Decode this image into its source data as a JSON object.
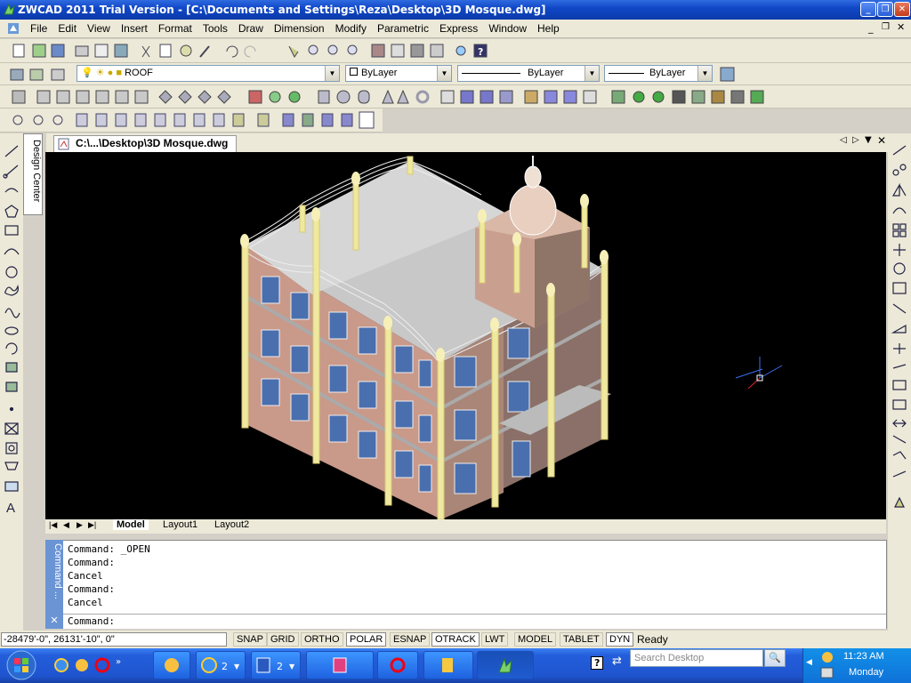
{
  "window": {
    "title": "ZWCAD 2011 Trial Version - [C:\\Documents and Settings\\Reza\\Desktop\\3D Mosque.dwg]"
  },
  "menu": [
    "File",
    "Edit",
    "View",
    "Insert",
    "Format",
    "Tools",
    "Draw",
    "Dimension",
    "Modify",
    "Parametric",
    "Express",
    "Window",
    "Help"
  ],
  "layers": {
    "current_layer": "ROOF",
    "color": "ByLayer",
    "linetype": "ByLayer",
    "lineweight": "ByLayer"
  },
  "design_center": {
    "label": "Design Center"
  },
  "document": {
    "tab_label": "C:\\...\\Desktop\\3D Mosque.dwg"
  },
  "layout_tabs": [
    "Model",
    "Layout1",
    "Layout2"
  ],
  "command": {
    "title": "Command ...",
    "history": [
      "Command: _OPEN",
      "Command:",
      "Cancel",
      "Command:",
      "Cancel"
    ],
    "prompt": "Command:"
  },
  "status": {
    "coordinates": "-28479'-0\",  26131'-10\",  0\"",
    "toggles": [
      "SNAP",
      "GRID",
      "ORTHO",
      "POLAR",
      "ESNAP",
      "OTRACK",
      "LWT",
      "MODEL",
      "TABLET",
      "DYN"
    ],
    "toggles_on": [
      "POLAR",
      "OTRACK",
      "DYN"
    ],
    "message": "Ready"
  },
  "taskbar": {
    "search_placeholder": "Search Desktop",
    "time": "11:23 AM",
    "day": "Monday",
    "ie_count": "2",
    "word_count": "2"
  },
  "colors": {
    "title": "#1148c8",
    "viewport": "#000000",
    "roof": "#c8c8c8",
    "wall": "#d9a898",
    "columns": "#f0eaa0"
  }
}
